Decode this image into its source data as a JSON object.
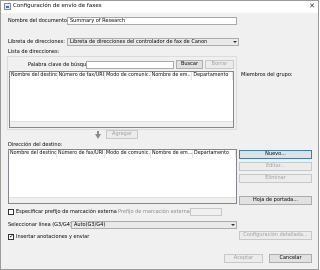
{
  "window": {
    "title": "Configuración de envío de faxes",
    "close_glyph": "✕"
  },
  "doc_name": {
    "label": "Nombre del documento:",
    "value": "Summary of Research"
  },
  "address_book": {
    "label": "Libreta de direcciones:",
    "selected": "Libreta de direcciones del controlador de fax de Canon"
  },
  "address_list": {
    "label": "Lista de direcciones:",
    "search_label": "Palabra clave de búsqueda:",
    "search_value": "",
    "search_button": "Buscar",
    "clear_button": "Borrar",
    "columns": [
      "Nombre del destino",
      "Número de fax/URI",
      "Modo de comunic...",
      "Nombre de em...",
      "Departamento"
    ],
    "group_members_label": "Miembros del grupo:"
  },
  "add_button": "Agregar",
  "destination": {
    "label": "Dirección del destino:",
    "columns": [
      "Nombre del destino",
      "Número de fax/URI",
      "Modo de comunic...",
      "Nombre de em...",
      "Departamento"
    ],
    "new_button": "Nuevo...",
    "edit_button": "Editar...",
    "delete_button": "Eliminar",
    "cover_button": "Hoja de portada..."
  },
  "prefix": {
    "checkbox_label": "Especificar prefijo de marcación externa",
    "field_label": "Prefijo de marcación externa:",
    "value": "",
    "checked": false
  },
  "line": {
    "label": "Seleccionar línea (G3/G4):",
    "selected": "Auto(G3/G4)",
    "detail_button": "Configuración detallada..."
  },
  "annotations": {
    "label": "Insertar anotaciones y enviar",
    "checked": true
  },
  "footer": {
    "accept_button": "Aceptar",
    "cancel_button": "Cancelar"
  }
}
